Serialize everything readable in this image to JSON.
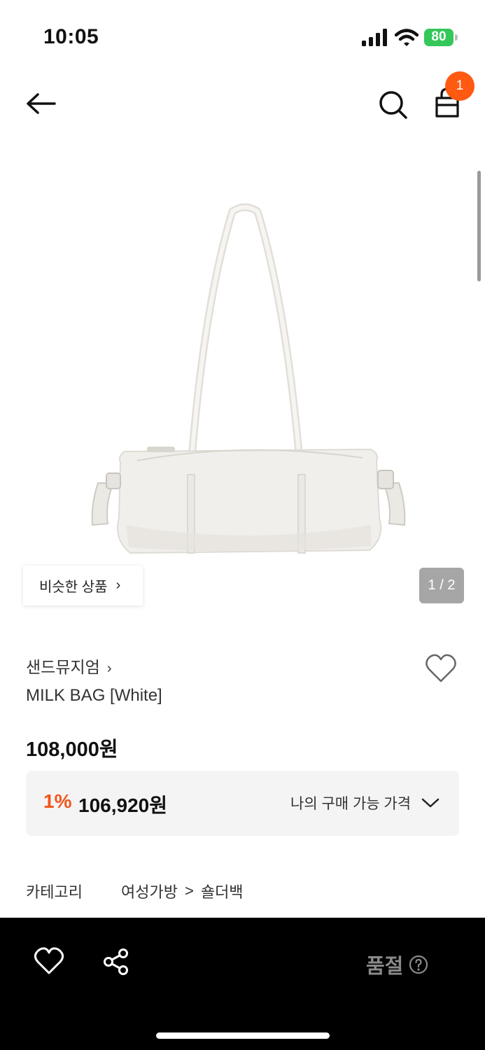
{
  "status_bar": {
    "time": "10:05",
    "battery": "80",
    "icons": [
      "signal-icon",
      "wifi-icon",
      "battery-icon"
    ]
  },
  "nav": {
    "cart_count": "1",
    "icons": [
      "back-arrow-icon",
      "search-icon",
      "shopping-bag-icon"
    ]
  },
  "gallery": {
    "similar_label": "비슷한 상품",
    "chevron": "›",
    "page_indicator": "1 / 2"
  },
  "product": {
    "brand": "샌드뮤지엄",
    "name": "MILK BAG [White]",
    "price": "108,000원",
    "discount_rate": "1%",
    "discount_price": "106,920원",
    "price_toggle_label": "나의 구매 가능 가격"
  },
  "category": {
    "label": "카테고리",
    "level1": "여성가방",
    "separator": ">",
    "level2": "숄더백"
  },
  "bottom_bar": {
    "status_label": "품절",
    "icons": [
      "heart-icon",
      "share-icon",
      "help-icon"
    ]
  },
  "colors": {
    "accent": "#ff5a12",
    "discount": "#f2541b",
    "battery": "#34c759",
    "bottom_bar": "#000000"
  }
}
